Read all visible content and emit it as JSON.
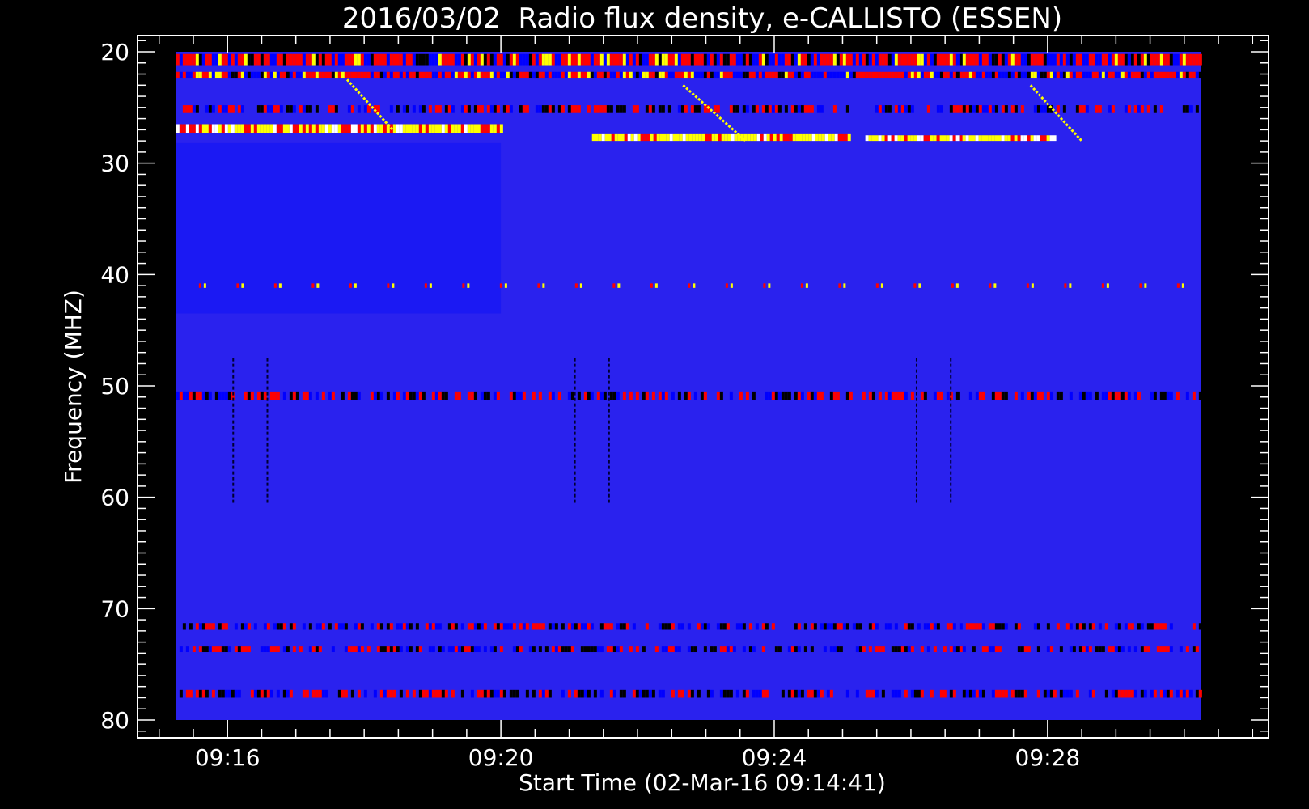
{
  "chart_data": {
    "type": "heatmap",
    "title": "2016/03/02  Radio flux density, e-CALLISTO (ESSEN)",
    "xlabel": "Start Time (02-Mar-16 09:14:41)",
    "ylabel": "Frequency (MHZ)",
    "x_tick_labels": [
      "09:16",
      "09:20",
      "09:24",
      "09:28"
    ],
    "y_tick_labels": [
      "20",
      "30",
      "40",
      "50",
      "60",
      "70",
      "80"
    ],
    "x_range": [
      "09:14:41",
      "09:31:14"
    ],
    "y_range": [
      20,
      80
    ],
    "y_reversed": true,
    "data_extent": {
      "t_start": "09:15:15",
      "t_end": "09:30:15",
      "f_min": 20,
      "f_max": 80
    },
    "colormap": [
      "#000000",
      "#0000ff",
      "#ff0000",
      "#ffff00",
      "#ffffff"
    ],
    "background_color": "#2a22ee",
    "features": [
      {
        "kind": "band",
        "t0": "09:15:15",
        "t1": "09:30:15",
        "f0": 20.2,
        "f1": 21.2,
        "intensity": "high"
      },
      {
        "kind": "band",
        "t0": "09:15:15",
        "t1": "09:30:15",
        "f0": 21.8,
        "f1": 22.4,
        "intensity": "high"
      },
      {
        "kind": "band",
        "t0": "09:15:15",
        "t1": "09:30:15",
        "f0": 24.8,
        "f1": 25.5,
        "intensity": "medium"
      },
      {
        "kind": "band",
        "t0": "09:15:15",
        "t1": "09:20:00",
        "f0": 26.5,
        "f1": 27.3,
        "intensity": "very-high"
      },
      {
        "kind": "band",
        "t0": "09:21:20",
        "t1": "09:25:05",
        "f0": 27.4,
        "f1": 28.0,
        "intensity": "very-high"
      },
      {
        "kind": "band",
        "t0": "09:25:20",
        "t1": "09:28:05",
        "f0": 27.5,
        "f1": 28.0,
        "intensity": "very-high"
      },
      {
        "kind": "band",
        "t0": "09:15:15",
        "t1": "09:30:15",
        "f0": 40.8,
        "f1": 41.2,
        "intensity": "dotted"
      },
      {
        "kind": "band",
        "t0": "09:15:15",
        "t1": "09:30:15",
        "f0": 50.5,
        "f1": 51.3,
        "intensity": "medium"
      },
      {
        "kind": "band",
        "t0": "09:15:15",
        "t1": "09:30:15",
        "f0": 71.3,
        "f1": 71.9,
        "intensity": "medium"
      },
      {
        "kind": "band",
        "t0": "09:15:15",
        "t1": "09:30:15",
        "f0": 73.4,
        "f1": 73.9,
        "intensity": "medium"
      },
      {
        "kind": "band",
        "t0": "09:15:15",
        "t1": "09:30:15",
        "f0": 77.3,
        "f1": 78.0,
        "intensity": "medium"
      },
      {
        "kind": "drift",
        "t0": "09:17:45",
        "f0": 22.5,
        "t1": "09:18:25",
        "f1": 27.0
      },
      {
        "kind": "drift",
        "t0": "09:22:40",
        "f0": 23.0,
        "t1": "09:23:35",
        "f1": 28.0
      },
      {
        "kind": "drift",
        "t0": "09:27:45",
        "f0": 23.0,
        "t1": "09:28:30",
        "f1": 28.0
      },
      {
        "kind": "dark-line",
        "t": "09:16:05",
        "f0": 47.5,
        "f1": 60.5
      },
      {
        "kind": "dark-line",
        "t": "09:16:35",
        "f0": 47.5,
        "f1": 60.5
      },
      {
        "kind": "dark-line",
        "t": "09:21:05",
        "f0": 47.5,
        "f1": 60.5
      },
      {
        "kind": "dark-line",
        "t": "09:21:35",
        "f0": 47.5,
        "f1": 60.5
      },
      {
        "kind": "dark-line",
        "t": "09:26:05",
        "f0": 47.5,
        "f1": 60.5
      },
      {
        "kind": "dark-line",
        "t": "09:26:35",
        "f0": 47.5,
        "f1": 60.5
      }
    ]
  }
}
